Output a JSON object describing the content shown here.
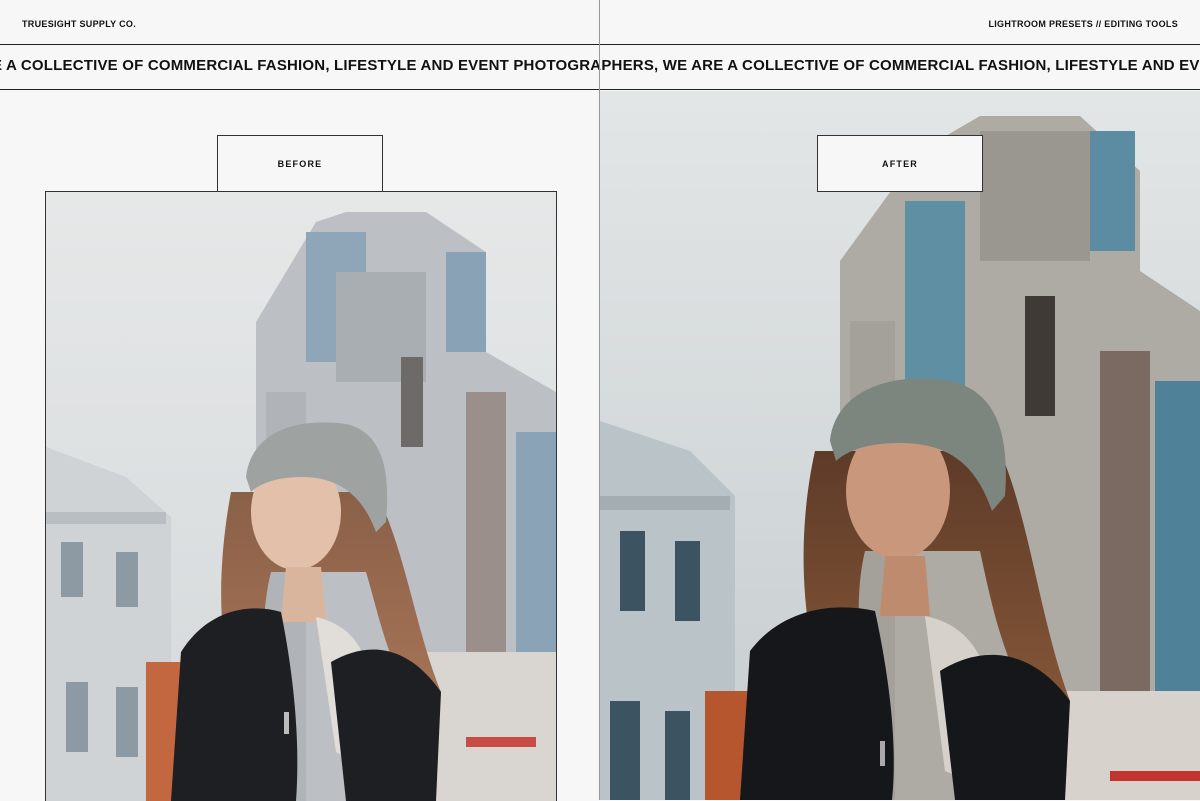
{
  "header": {
    "brand": "TRUESIGHT SUPPLY CO.",
    "tagline": "LIGHTROOM PRESETS // EDITING TOOLS"
  },
  "ticker": {
    "text": "E A COLLECTIVE OF COMMERCIAL FASHION, LIFESTYLE AND EVENT PHOTOGRAPHERS, WE ARE A COLLECTIVE OF COMMERCIAL FASHION, LIFESTYLE AND EVENT PHOTOGRAPHERS"
  },
  "comparison": {
    "before_label": "BEFORE",
    "after_label": "AFTER"
  },
  "colors": {
    "background": "#f6f7f6",
    "ink": "#111111",
    "before_sky": "#dfe2e3",
    "after_sky": "#cfd5d7"
  }
}
